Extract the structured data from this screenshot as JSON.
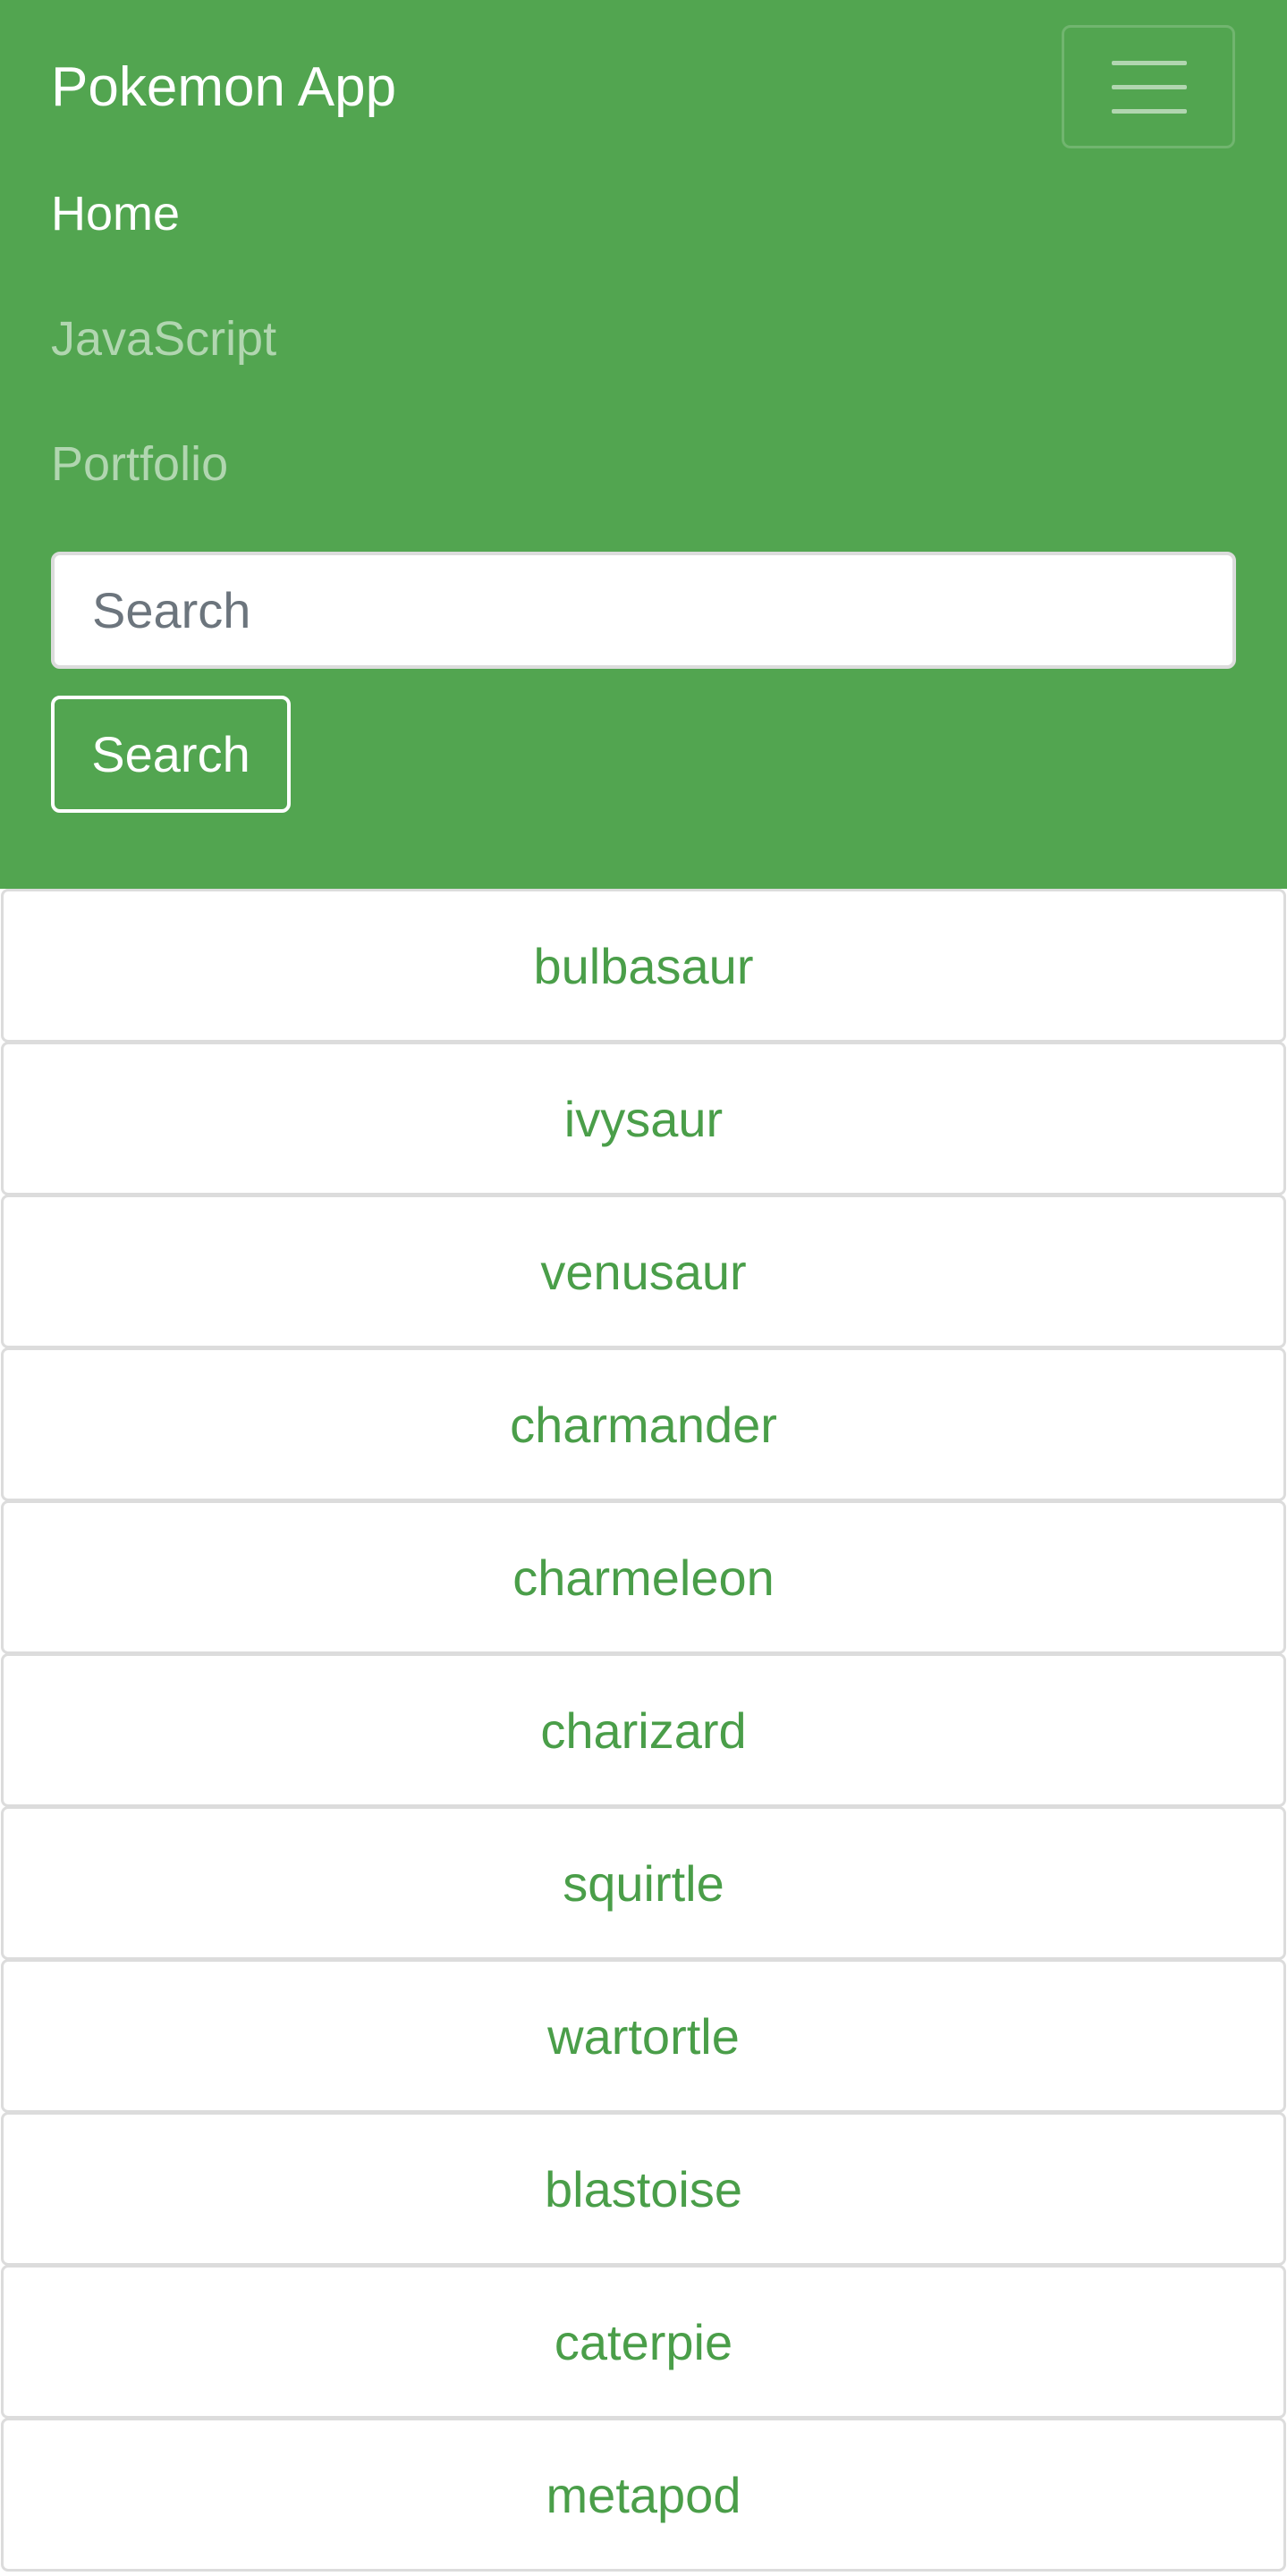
{
  "navbar": {
    "brand": "Pokemon App",
    "toggle_icon": "hamburger-menu-icon",
    "links": [
      {
        "label": "Home",
        "active": true
      },
      {
        "label": "JavaScript",
        "active": false
      },
      {
        "label": "Portfolio",
        "active": false
      }
    ],
    "search": {
      "placeholder": "Search",
      "value": "",
      "button_label": "Search"
    }
  },
  "pokemon_list": [
    "bulbasaur",
    "ivysaur",
    "venusaur",
    "charmander",
    "charmeleon",
    "charizard",
    "squirtle",
    "wartortle",
    "blastoise",
    "caterpie",
    "metapod"
  ],
  "colors": {
    "navbar_bg": "#52a550",
    "accent_text": "#4a9e49"
  }
}
